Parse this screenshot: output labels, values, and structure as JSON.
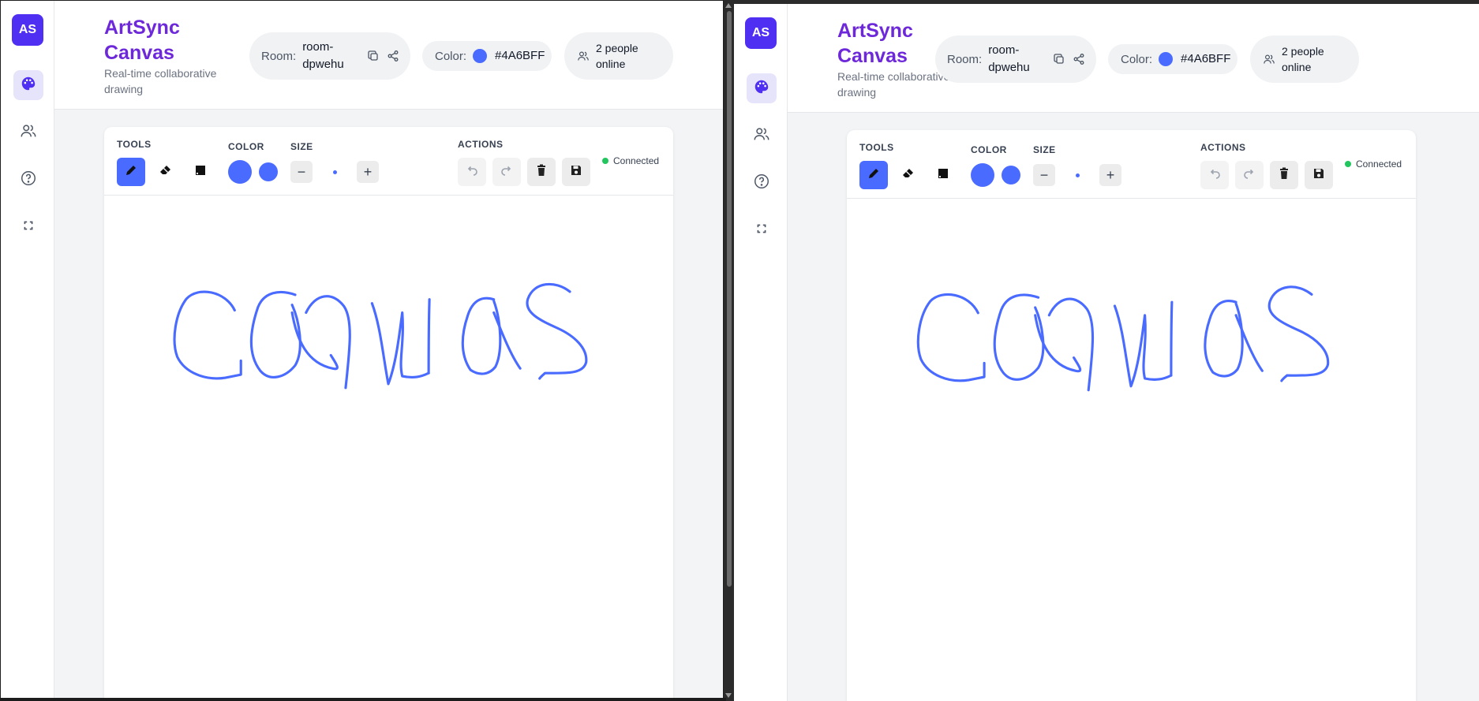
{
  "app": {
    "avatar_initials": "AS",
    "title": "ArtSync Canvas",
    "subtitle": "Real-time collaborative drawing"
  },
  "sidebar": {
    "items": [
      {
        "icon": "palette-icon",
        "active": true
      },
      {
        "icon": "users-icon",
        "active": false
      },
      {
        "icon": "help-icon",
        "active": false
      },
      {
        "icon": "fullscreen-icon",
        "active": false
      }
    ]
  },
  "header": {
    "room_label": "Room:",
    "room_value": "room-dpwehu",
    "color_label": "Color:",
    "color_value": "#4A6BFF",
    "online_text": "2 people online"
  },
  "toolbar": {
    "tools_label": "TOOLS",
    "color_label": "COLOR",
    "size_label": "SIZE",
    "actions_label": "ACTIONS",
    "status_text": "Connected",
    "tools": [
      "pencil-icon",
      "eraser-icon",
      "square-icon"
    ],
    "actions": [
      "undo-icon",
      "redo-icon",
      "trash-icon",
      "save-icon"
    ]
  },
  "canvas": {
    "drawn_text": "canvas",
    "stroke_color": "#4A6BFF"
  }
}
